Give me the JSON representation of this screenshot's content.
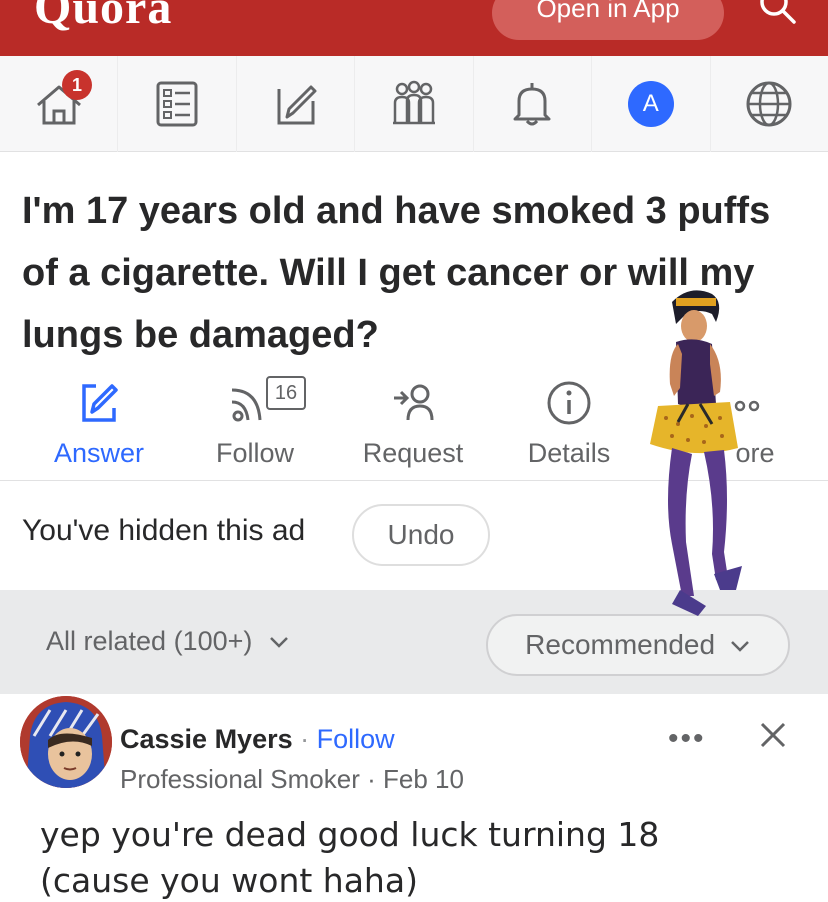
{
  "brand": {
    "logo": "Quora",
    "open_app": "Open in App"
  },
  "nav": {
    "items": [
      {
        "icon": "home-icon",
        "badge": "1"
      },
      {
        "icon": "list-icon"
      },
      {
        "icon": "edit-icon"
      },
      {
        "icon": "spaces-icon"
      },
      {
        "icon": "bell-icon"
      },
      {
        "icon": "avatar",
        "letter": "A"
      },
      {
        "icon": "globe-icon"
      }
    ]
  },
  "question": {
    "title": "I'm 17 years old and have smoked 3 puffs of a cigarette. Will I get cancer or will my lungs be damaged?"
  },
  "actions": {
    "answer": "Answer",
    "follow": "Follow",
    "follow_count": "16",
    "request": "Request",
    "details": "Details",
    "more": "ore"
  },
  "hidden_ad": {
    "text": "You've hidden this ad",
    "undo": "Undo"
  },
  "related": {
    "all_related": "All related (100+)",
    "recommended": "Recommended"
  },
  "answer": {
    "author": "Cassie Myers",
    "separator": "·",
    "follow": "Follow",
    "credential": "Professional Smoker · Feb 10",
    "more": "•••",
    "line1": "yep you're dead good luck turning 18",
    "line2": "(cause you wont haha)"
  },
  "colors": {
    "brand_red": "#b92b27",
    "link_blue": "#2e69ff",
    "badge_red": "#c8332d"
  }
}
